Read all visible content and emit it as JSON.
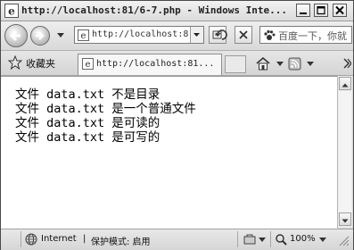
{
  "window": {
    "title": "http://localhost:81/6-7.php - Windows Inte..."
  },
  "nav": {
    "address": "http://localhost:8",
    "search_placeholder": "百度一下，你就"
  },
  "favorites": {
    "label": "收藏夹"
  },
  "tab": {
    "title": "http://localhost:81..."
  },
  "content": {
    "lines": [
      "文件 data.txt 不是目录",
      "文件 data.txt 是一个普通文件",
      "文件 data.txt 是可读的",
      "文件 data.txt 是可写的"
    ]
  },
  "status": {
    "zone": "Internet",
    "protected_mode": "保护模式: 启用",
    "zoom": "100%"
  },
  "icons": {
    "ie": "ie-logo-icon",
    "back": "back-arrow-icon",
    "forward": "forward-arrow-icon",
    "star": "star-icon",
    "home": "home-icon",
    "rss": "rss-icon",
    "globe": "globe-icon",
    "search": "baidu-paw-icon"
  }
}
